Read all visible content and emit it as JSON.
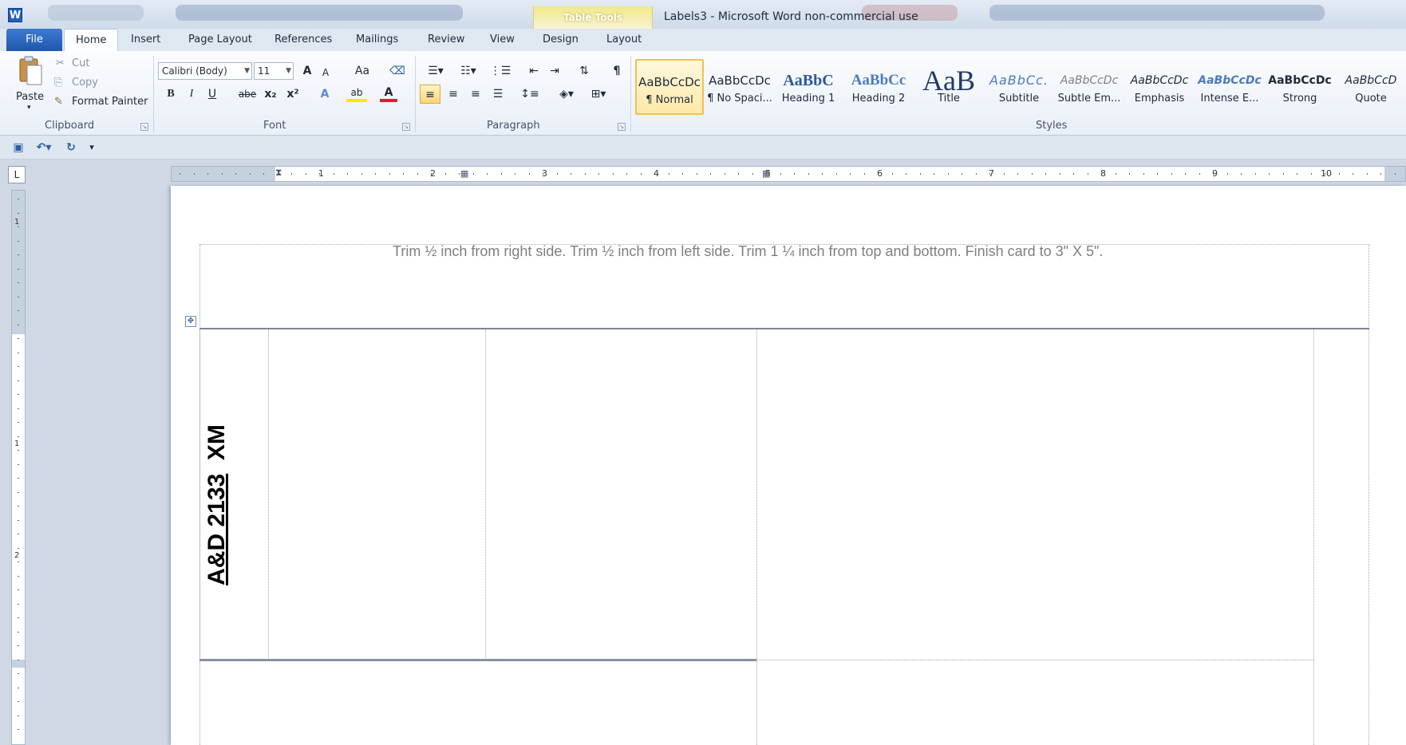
{
  "window": {
    "app_icon": "W",
    "title": "Labels3 - Microsoft Word non-commercial use",
    "context_tab_title": "Table Tools"
  },
  "tabs": [
    "File",
    "Home",
    "Insert",
    "Page Layout",
    "References",
    "Mailings",
    "Review",
    "View",
    "Design",
    "Layout"
  ],
  "active_tab": "Home",
  "ribbon": {
    "clipboard": {
      "paste": "Paste",
      "cut": "Cut",
      "copy": "Copy",
      "format_painter": "Format Painter",
      "label": "Clipboard"
    },
    "font": {
      "font_name": "Calibri (Body)",
      "font_size": "11",
      "grow": "A",
      "shrink": "A",
      "change_case": "Aa",
      "bold": "B",
      "italic": "I",
      "underline": "U",
      "strike": "abe",
      "subscript": "x₂",
      "superscript": "x²",
      "text_effects": "A",
      "highlight": "ab",
      "font_color": "A",
      "label": "Font"
    },
    "paragraph": {
      "label": "Paragraph",
      "pilcrow": "¶"
    },
    "styles": {
      "label": "Styles",
      "items": [
        {
          "sample": "AaBbCcDc",
          "name": "¶ Normal"
        },
        {
          "sample": "AaBbCcDc",
          "name": "¶ No Spaci..."
        },
        {
          "sample": "AaBbC",
          "name": "Heading 1"
        },
        {
          "sample": "AaBbCc",
          "name": "Heading 2"
        },
        {
          "sample": "AaB",
          "name": "Title"
        },
        {
          "sample": "AaBbCc.",
          "name": "Subtitle"
        },
        {
          "sample": "AaBbCcDc",
          "name": "Subtle Em..."
        },
        {
          "sample": "AaBbCcDc",
          "name": "Emphasis"
        },
        {
          "sample": "AaBbCcDc",
          "name": "Intense E..."
        },
        {
          "sample": "AaBbCcDc",
          "name": "Strong"
        },
        {
          "sample": "AaBbCcD",
          "name": "Quote"
        }
      ]
    }
  },
  "ruler": {
    "h_numbers": [
      "1",
      "2",
      "3",
      "4",
      "5",
      "6",
      "7",
      "8",
      "9",
      "10"
    ],
    "v_numbers": [
      "1",
      "1",
      "2"
    ],
    "tab_selector": "L"
  },
  "document": {
    "trim_note": "Trim ½ inch from right side.  Trim ½ inch from left side.  Trim 1 ¼ inch from top and bottom.  Finish card to 3\" X 5\".",
    "label_underlined": "A&D 2133",
    "label_rest": "XM"
  },
  "colors": {
    "file_tab": "#1d57ad",
    "context_tab": "#f2e98a",
    "selected_style": "#f2c05a",
    "trim_text": "#7f7f7f"
  }
}
